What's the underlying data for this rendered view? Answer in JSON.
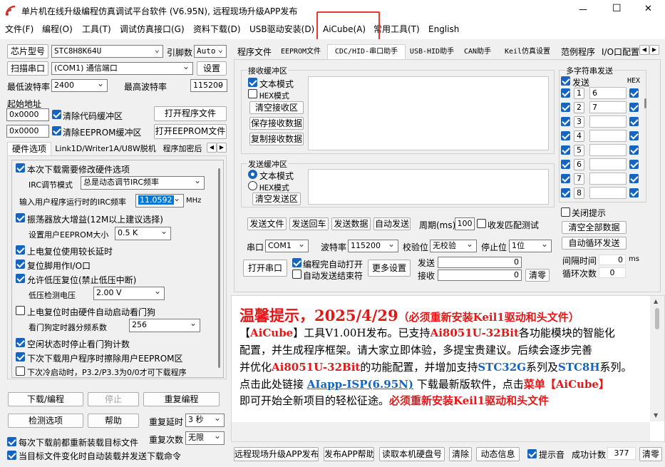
{
  "titlebar": {
    "title": "单片机在线升级编程仿真调试平台软件 (V6.95N), 远程现场升级APP发布",
    "min": "—",
    "max": "☐",
    "close": "✕"
  },
  "menu": [
    "文件(F)",
    "编程(O)",
    "工具(T)",
    "调试仿真接口(G)",
    "资料下载(D)",
    "USB驱动安装(D)",
    "AiCube(A)",
    "常用工具(T)",
    "English"
  ],
  "left": {
    "chip_btn": "芯片型号",
    "chip_val": "STC8H8K64U",
    "engine_lbl": "引脚数",
    "engine_val": "Auto",
    "scan_btn": "扫描串口",
    "port_val": "(COM1) 通信端口",
    "settings_btn": "设置",
    "min_baud_lbl": "最低波特率",
    "min_baud_val": "2400",
    "max_baud_lbl": "最高波特率",
    "max_baud_val": "115200",
    "start_addr_lbl": "起始地址",
    "addr1": "0x0000",
    "clear_code": "清除代码缓冲区",
    "open_prog_btn": "打开程序文件",
    "addr2": "0x0000",
    "clear_eeprom": "清除EEPROM缓冲区",
    "open_eeprom_btn": "打开EEPROM文件",
    "tabs": [
      "硬件选项",
      "Link1D/Writer1A/U8W脱机",
      "程序加密后"
    ],
    "opts": {
      "o1": "本次下载需要修改硬件选项",
      "irc_mode_lbl": "IRC调节模式",
      "irc_mode_val": "总是动态调节IRC频率",
      "irc_freq_lbl": "输入用户程序运行时的IRC频率",
      "irc_freq_val": "11.0592",
      "irc_unit": "MHz",
      "o2": "振荡器放大增益(12M以上建议选择)",
      "eeprom_lbl": "设置用户EEPROM大小",
      "eeprom_val": "0.5 K",
      "o3": "上电复位使用较长延时",
      "o4": "复位脚用作I/O口",
      "o5": "允许低压复位(禁止低压中断)",
      "lv_lbl": "低压检测电压",
      "lv_val": "2.00 V",
      "o6": "上电复位时由硬件自动启动看门狗",
      "wdt_lbl": "看门狗定时器分频系数",
      "wdt_val": "256",
      "o7": "空闲状态时停止看门狗计数",
      "o8": "下次下载用户程序时擦除用户EEPROM区",
      "o9": "下次冷启动时，P3.2/P3.3为0/0才可下载程序"
    },
    "download_btn": "下载/编程",
    "stop_btn": "停止",
    "reprog_btn": "重复编程",
    "detect_btn": "检测选项",
    "help_btn": "帮助",
    "delay_lbl": "重复延时",
    "delay_val": "3 秒",
    "reload_lbl": "每次下载前都重新装载目标文件",
    "times_lbl": "重复次数",
    "times_val": "无限",
    "auto_lbl": "当目标文件变化时自动装载并发送下载命令"
  },
  "right_tabs": [
    "程序文件",
    "EEPROM文件",
    "CDC/HID-串口助手",
    "USB-HID助手",
    "CAN助手",
    "Keil仿真设置",
    "范例程序",
    "I/O口配置"
  ],
  "serial": {
    "recv_title": "接收缓冲区",
    "recv_text": "文本模式",
    "recv_hex": "HEX模式",
    "clear_recv": "清空接收区",
    "save_recv": "保存接收数据",
    "copy_recv": "复制接收数据",
    "send_title": "发送缓冲区",
    "send_text": "文本模式",
    "send_hex": "HEX模式",
    "clear_send": "清空发送区",
    "send_file": "发送文件",
    "send_back": "发送回车",
    "send_data": "发送数据",
    "auto_send": "自动发送",
    "period_lbl": "周期(ms)",
    "period_val": "100",
    "match": "收发匹配测试",
    "port_lbl": "串口",
    "port_val": "COM1",
    "baud_lbl": "波特率",
    "baud_val": "115200",
    "parity_lbl": "校验位",
    "parity_val": "无校验",
    "stop_lbl": "停止位",
    "stop_val": "1位",
    "open_btn": "打开串口",
    "opt1": "编程完自动打开",
    "opt2": "自动发送结束符",
    "more_btn": "更多设置",
    "sent_lbl": "发送",
    "sent_val": "0",
    "recvd_lbl": "接收",
    "recvd_val": "0",
    "zero_btn": "清零"
  },
  "multi": {
    "title": "多字符串发送",
    "send_col": "发送",
    "hex_col": "HEX",
    "rows": [
      {
        "n": "1",
        "v": "6"
      },
      {
        "n": "2",
        "v": "7"
      },
      {
        "n": "3",
        "v": ""
      },
      {
        "n": "4",
        "v": ""
      },
      {
        "n": "5",
        "v": ""
      },
      {
        "n": "6",
        "v": ""
      },
      {
        "n": "7",
        "v": ""
      },
      {
        "n": "8",
        "v": ""
      }
    ],
    "close_tip": "关闭提示",
    "clear_all": "清空全部数据",
    "auto_loop": "自动循环发送",
    "interval_lbl": "间隔时间",
    "interval_val": "0",
    "interval_unit": "ms",
    "loop_lbl": "循环次数",
    "loop_val": "0"
  },
  "notice": {
    "title": "温馨提示，2025/4/29",
    "title_note": "（必须重新安装Keil1驱动和头文件）",
    "l1a": "【",
    "l1b": "AiCube",
    "l1c": "】工具V1.00H发布。已支持",
    "l1d": "Ai8051U-32Bit",
    "l1e": "各功能模块的智能化",
    "l2": "配置，并生成程序框架。请大家立即体验，多提宝贵建议。后续会逐步完善",
    "l3a": "并优化",
    "l3b": "Ai8051U-32Bit",
    "l3c": "的功能配置，并增加支持",
    "l3d": "STC32G",
    "l3e": "系列及",
    "l3f": "STC8H",
    "l3g": "系列。",
    "l4a": "点击此处链接",
    "l4b": "AIapp-ISP(6.95N)",
    "l4c": "下载最新版软件，点击",
    "l4d": "菜单【",
    "l4e": "AiCube",
    "l4f": "】",
    "l5a": "即可开始全新项目的轻松征途。",
    "l5b": "必须重新安装Keil1驱动和头文件"
  },
  "bottom": {
    "remote_btn": "远程现场升级APP发布",
    "publish_btn": "发布APP帮助",
    "read_btn": "读取本机硬盘号",
    "clear_btn": "清除",
    "dyn_btn": "动态信息",
    "sound_lbl": "提示音",
    "count_lbl": "成功计数",
    "count_val": "377",
    "clear2_btn": "清零"
  }
}
